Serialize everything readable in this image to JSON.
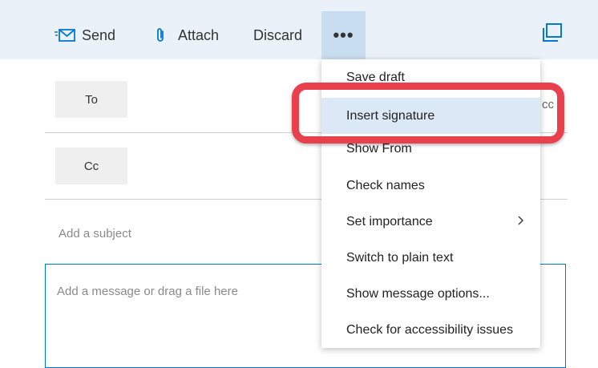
{
  "toolbar": {
    "send_label": "Send",
    "attach_label": "Attach",
    "discard_label": "Discard",
    "more_label": "•••"
  },
  "fields": {
    "to_label": "To",
    "cc_label": "Cc",
    "cc_link_partial": "cc",
    "subject_placeholder": "Add a subject",
    "body_placeholder": "Add a message or drag a file here"
  },
  "menu": {
    "items": [
      {
        "label": "Save draft"
      },
      {
        "label": "Insert signature",
        "highlighted": true
      },
      {
        "label": "Show From"
      },
      {
        "label": "Check names"
      },
      {
        "label": "Set importance",
        "submenu": true
      },
      {
        "label": "Switch to plain text"
      },
      {
        "label": "Show message options..."
      },
      {
        "label": "Check for accessibility issues"
      }
    ]
  },
  "colors": {
    "toolbar_bg": "#eaf1f9",
    "accent": "#0078d7",
    "callout": "#e8404c",
    "highlight": "#dbe9f7"
  },
  "icons": {
    "send": "send-envelope-icon",
    "attach": "paperclip-icon",
    "popout": "popout-window-icon",
    "submenu": "chevron-right-icon"
  }
}
